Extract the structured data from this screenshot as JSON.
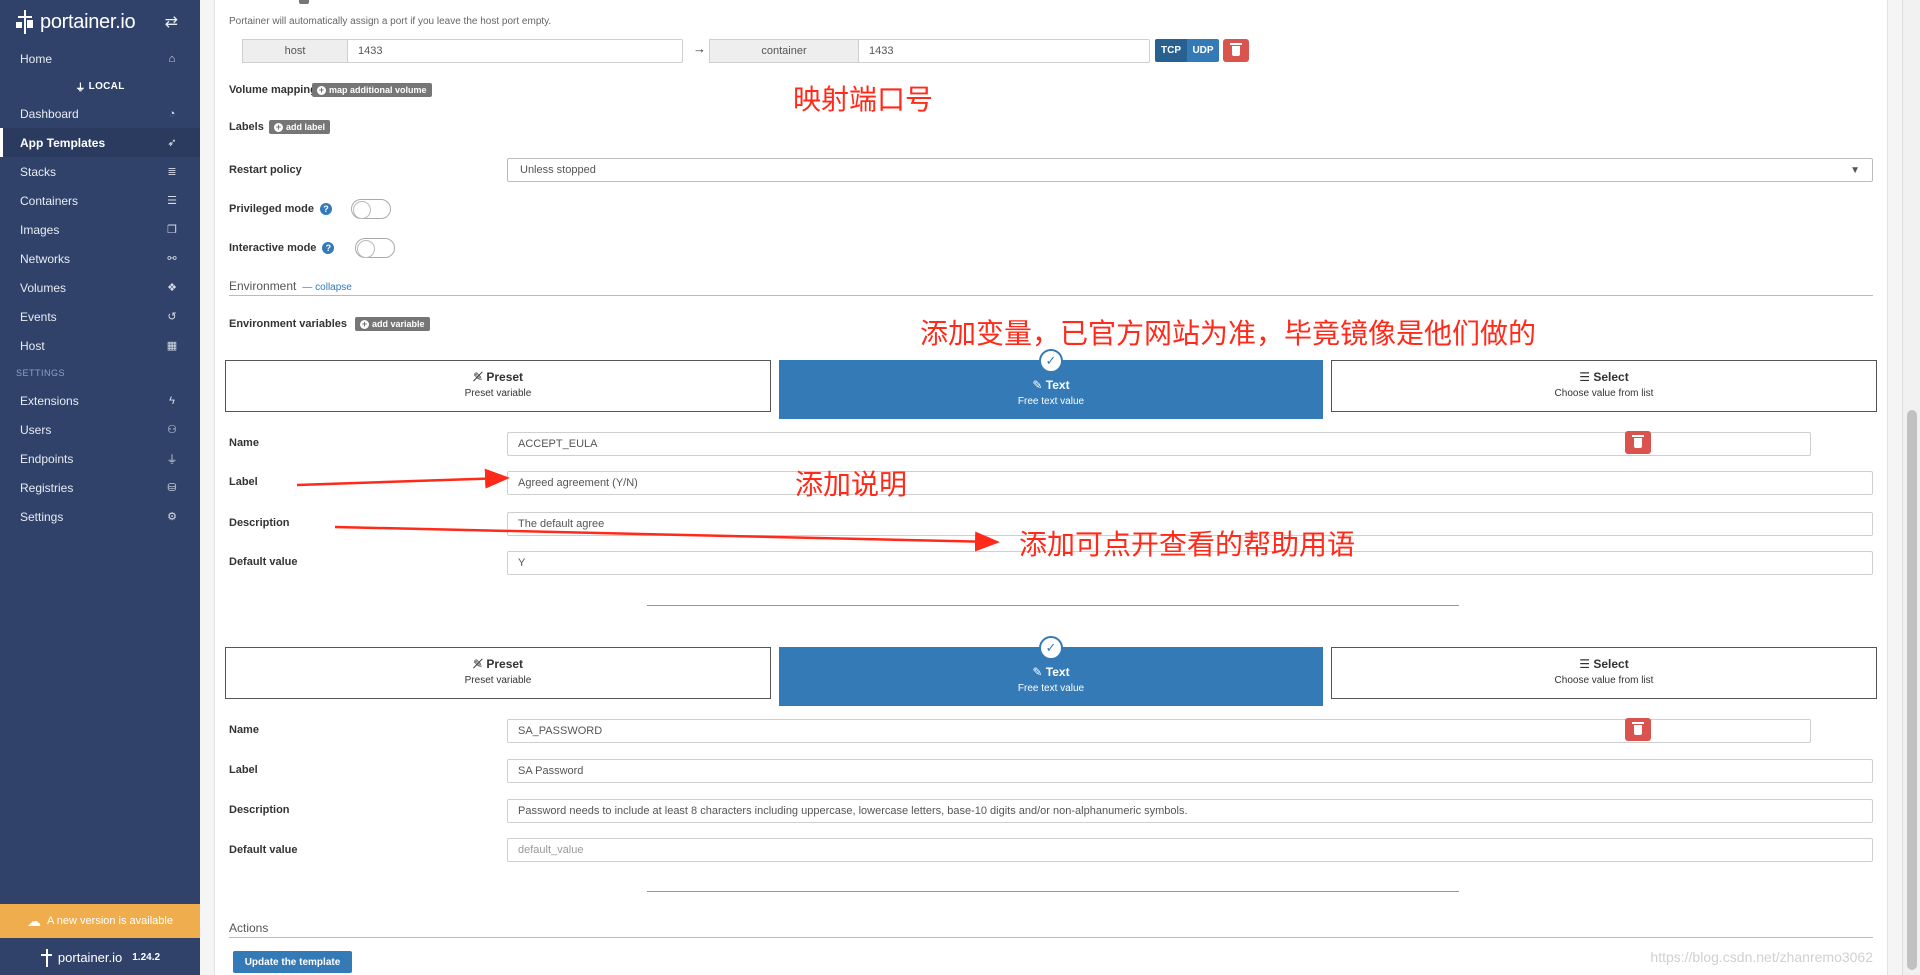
{
  "sidebar": {
    "logo_text": "portainer.io",
    "items_top": [
      {
        "label": "Home",
        "icon": "home-icon",
        "glyph": "⌂"
      }
    ],
    "endpoint_label": "LOCAL",
    "items_endpoint": [
      {
        "label": "Dashboard",
        "icon": "dashboard-icon",
        "glyph": "◔"
      },
      {
        "label": "App Templates",
        "icon": "rocket-icon",
        "glyph": "➶"
      },
      {
        "label": "Stacks",
        "icon": "list-icon",
        "glyph": "≣"
      },
      {
        "label": "Containers",
        "icon": "server-icon",
        "glyph": "☰"
      },
      {
        "label": "Images",
        "icon": "clone-icon",
        "glyph": "❐"
      },
      {
        "label": "Networks",
        "icon": "sitemap-icon",
        "glyph": "⚯"
      },
      {
        "label": "Volumes",
        "icon": "cubes-icon",
        "glyph": "❖"
      },
      {
        "label": "Events",
        "icon": "history-icon",
        "glyph": "↺"
      },
      {
        "label": "Host",
        "icon": "th-icon",
        "glyph": "▦"
      }
    ],
    "settings_section": "SETTINGS",
    "items_settings": [
      {
        "label": "Extensions",
        "icon": "bolt-icon",
        "glyph": "ϟ"
      },
      {
        "label": "Users",
        "icon": "users-icon",
        "glyph": "⚇"
      },
      {
        "label": "Endpoints",
        "icon": "plug-icon",
        "glyph": "⏚"
      },
      {
        "label": "Registries",
        "icon": "database-icon",
        "glyph": "⛁"
      },
      {
        "label": "Settings",
        "icon": "cogs-icon",
        "glyph": "⚙"
      }
    ],
    "update_banner": "A new version is available",
    "footer_logo": "portainer.io",
    "footer_version": "1.24.2"
  },
  "port": {
    "hint": "Portainer will automatically assign a port if you leave the host port empty.",
    "host_addon": "host",
    "host_value": "1433",
    "container_addon": "container",
    "container_value": "1433",
    "arrow": "→",
    "tcp": "TCP",
    "udp": "UDP"
  },
  "volume": {
    "label": "Volume mapping",
    "btn": "map additional volume"
  },
  "labels": {
    "label": "Labels",
    "btn": "add label"
  },
  "restart": {
    "label": "Restart policy",
    "value": "Unless stopped"
  },
  "privileged": {
    "label": "Privileged mode"
  },
  "interactive": {
    "label": "Interactive mode"
  },
  "environment": {
    "title": "Environment",
    "collapse": "collapse"
  },
  "envvars": {
    "label": "Environment variables",
    "btn": "add variable"
  },
  "types": {
    "preset_title": "Preset",
    "preset_sub": "Preset variable",
    "text_title": "Text",
    "text_sub": "Free text value",
    "select_title": "Select",
    "select_sub": "Choose value from list"
  },
  "field_labels": {
    "name": "Name",
    "label": "Label",
    "description": "Description",
    "default": "Default value"
  },
  "var1": {
    "name": "ACCEPT_EULA",
    "label": "Agreed agreement (Y/N)",
    "description": "The default agree",
    "default": "Y"
  },
  "var2": {
    "name": "SA_PASSWORD",
    "label": "SA Password",
    "description": "Password needs to include at least 8 characters including uppercase, lowercase letters, base-10 digits and/or non-alphanumeric symbols.",
    "default_placeholder": "default_value"
  },
  "actions": {
    "title": "Actions",
    "update_btn": "Update the template"
  },
  "annotations": {
    "port": "映射端口号",
    "variable": "添加变量，已官方网站为准，毕竟镜像是他们做的",
    "label": "添加说明",
    "help": "添加可点开查看的帮助用语"
  },
  "watermark": "https://blog.csdn.net/zhanremo3062",
  "colors": {
    "sidebar": "#30426a",
    "primary": "#337ab7",
    "danger": "#d9534f",
    "warning": "#f0ad4e",
    "annotation": "#ff2a1a"
  }
}
